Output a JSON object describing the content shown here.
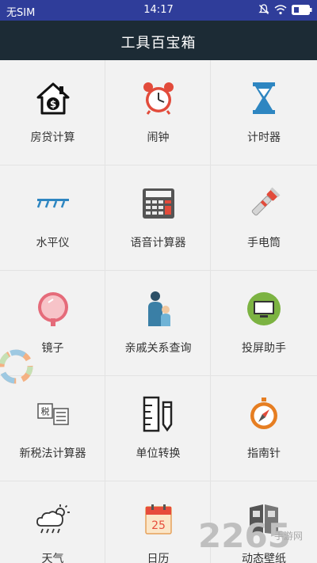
{
  "status": {
    "carrier": "无SIM",
    "time": "14:17"
  },
  "appbar": {
    "title": "工具百宝箱"
  },
  "tools": [
    {
      "label": "房贷计算",
      "icon": "house-dollar-icon"
    },
    {
      "label": "闹钟",
      "icon": "alarm-clock-icon"
    },
    {
      "label": "计时器",
      "icon": "hourglass-icon"
    },
    {
      "label": "水平仪",
      "icon": "level-icon"
    },
    {
      "label": "语音计算器",
      "icon": "calculator-icon"
    },
    {
      "label": "手电筒",
      "icon": "flashlight-icon"
    },
    {
      "label": "镜子",
      "icon": "mirror-icon"
    },
    {
      "label": "亲戚关系查询",
      "icon": "family-icon"
    },
    {
      "label": "投屏助手",
      "icon": "screen-cast-icon"
    },
    {
      "label": "新税法计算器",
      "icon": "tax-icon"
    },
    {
      "label": "单位转换",
      "icon": "unit-convert-icon"
    },
    {
      "label": "指南针",
      "icon": "compass-icon"
    },
    {
      "label": "天气",
      "icon": "weather-icon"
    },
    {
      "label": "日历",
      "icon": "calendar-icon",
      "day": "25"
    },
    {
      "label": "动态壁纸",
      "icon": "wallpaper-icon"
    }
  ],
  "watermark": {
    "brand": "2265",
    "sub": "手游网"
  },
  "colors": {
    "statusbar": "#2f3d9a",
    "appbar": "#1c2b35"
  }
}
